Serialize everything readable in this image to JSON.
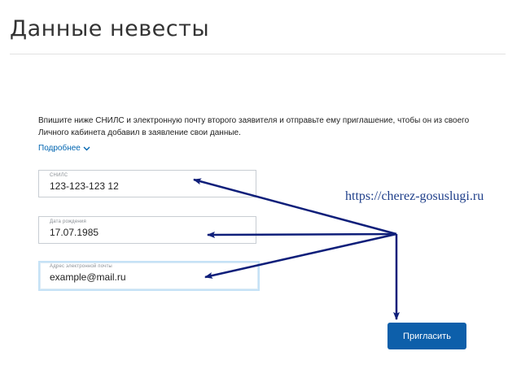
{
  "page": {
    "title": "Данные невесты"
  },
  "form": {
    "instruction": "Впишите ниже СНИЛС и электронную почту второго заявителя и отправьте ему приглашение, чтобы он из своего Личного кабинета добавил в заявление свои данные.",
    "more_link": "Подробнее",
    "fields": {
      "snils": {
        "label": "СНИЛС",
        "value": "123-123-123 12"
      },
      "birth_date": {
        "label": "Дата рождения",
        "value": "17.07.1985"
      },
      "email": {
        "label": "Адрес электронной почты",
        "value": "example@mail.ru"
      }
    },
    "invite_button": "Пригласить"
  },
  "annotation": {
    "watermark": "https://cherez-gosuslugi.ru",
    "arrow_color": "#0f1f7a"
  },
  "icons": {
    "more_link": "chevron-down-icon"
  },
  "colors": {
    "link": "#0065b1",
    "button": "#0d5faa",
    "focus_border": "#c5e2f6"
  }
}
